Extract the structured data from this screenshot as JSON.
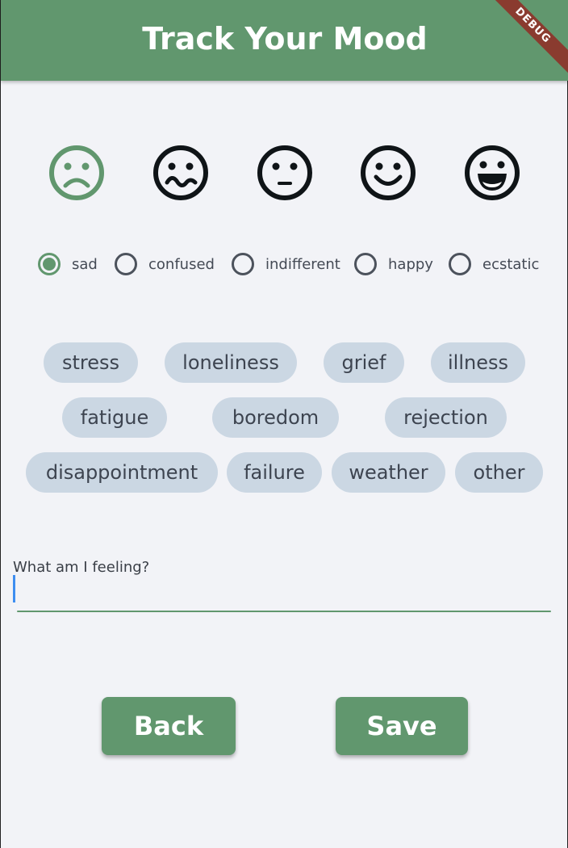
{
  "appbar": {
    "title": "Track Your Mood",
    "debug_label": "DEBUG"
  },
  "colors": {
    "primary": "#61976e",
    "chip_bg": "#cbd7e3",
    "background": "#f2f3f7"
  },
  "faces": [
    {
      "icon": "sad-face-icon",
      "selected": true
    },
    {
      "icon": "confused-face-icon",
      "selected": false
    },
    {
      "icon": "neutral-face-icon",
      "selected": false
    },
    {
      "icon": "happy-face-icon",
      "selected": false
    },
    {
      "icon": "ecstatic-face-icon",
      "selected": false
    }
  ],
  "moods": [
    {
      "label": "sad",
      "selected": true
    },
    {
      "label": "confused",
      "selected": false
    },
    {
      "label": "indifferent",
      "selected": false
    },
    {
      "label": "happy",
      "selected": false
    },
    {
      "label": "ecstatic",
      "selected": false
    }
  ],
  "chips": [
    "stress",
    "loneliness",
    "grief",
    "illness",
    "fatigue",
    "boredom",
    "rejection",
    "disappointment",
    "failure",
    "weather",
    "other"
  ],
  "input": {
    "label": "What am I feeling?",
    "value": ""
  },
  "buttons": {
    "back": "Back",
    "save": "Save"
  }
}
